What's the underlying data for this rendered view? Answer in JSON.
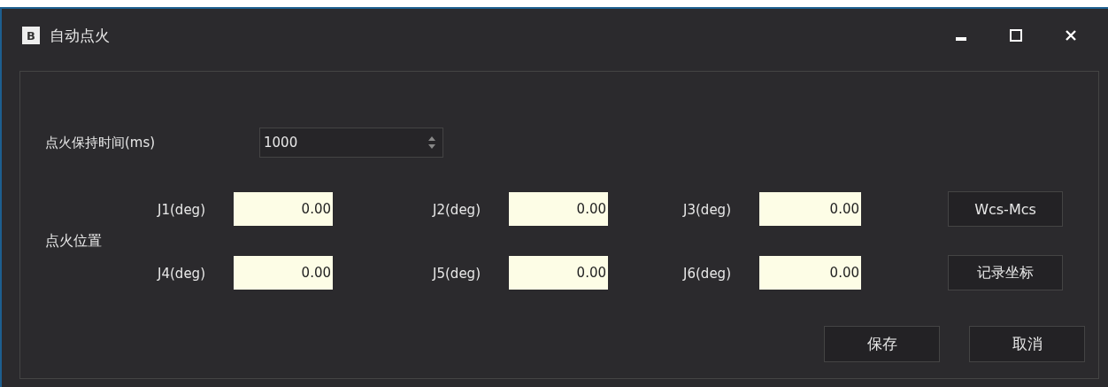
{
  "window": {
    "app_icon": "B",
    "title": "自动点火"
  },
  "hold_time": {
    "label": "点火保持时间(ms)",
    "value": "1000"
  },
  "position": {
    "label": "点火位置",
    "joints": [
      {
        "label": "J1(deg)",
        "value": "0.00"
      },
      {
        "label": "J2(deg)",
        "value": "0.00"
      },
      {
        "label": "J3(deg)",
        "value": "0.00"
      },
      {
        "label": "J4(deg)",
        "value": "0.00"
      },
      {
        "label": "J5(deg)",
        "value": "0.00"
      },
      {
        "label": "J6(deg)",
        "value": "0.00"
      }
    ]
  },
  "side_buttons": [
    "Wcs-Mcs",
    "记录坐标"
  ],
  "footer_buttons": [
    "保存",
    "取消"
  ]
}
